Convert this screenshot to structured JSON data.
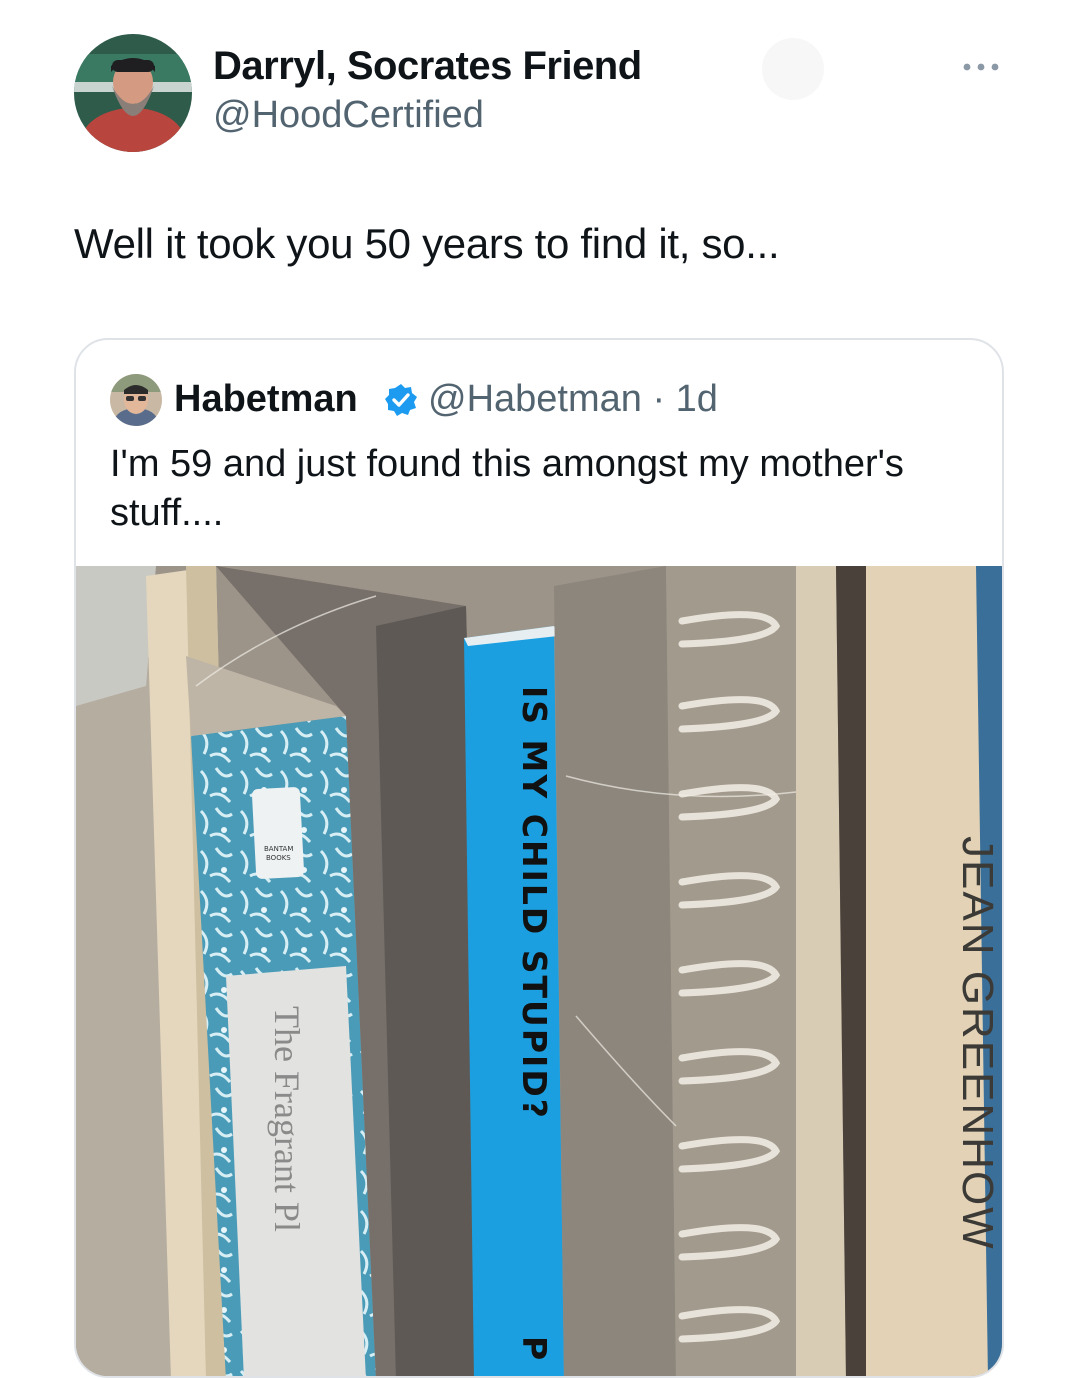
{
  "tweet": {
    "author_name": "Darryl, Socrates Friend",
    "author_handle": "@HoodCertified",
    "text": "Well it took you 50 years to find it, so...",
    "more_icon": "more-horizontal-icon"
  },
  "quoted_tweet": {
    "author_name": "Habetman",
    "verified_icon": "verified-badge-icon",
    "handle_time": "@Habetman · 1d",
    "text": "I'm 59 and just found this amongst my mother's stuff....",
    "photo": {
      "book_spine_blue": "IS MY CHILD STUPID?",
      "book_spine_blue_cut": "P",
      "book_spine_right": "JEAN GREENHOW",
      "book_cover_title": "The Fragrant Pl",
      "publisher_badge": "BANTAM BOOKS"
    }
  },
  "colors": {
    "primary_text": "#0f1419",
    "secondary_text": "#536471",
    "verified_blue": "#1d9bf0",
    "card_border": "#dfe3e7"
  }
}
